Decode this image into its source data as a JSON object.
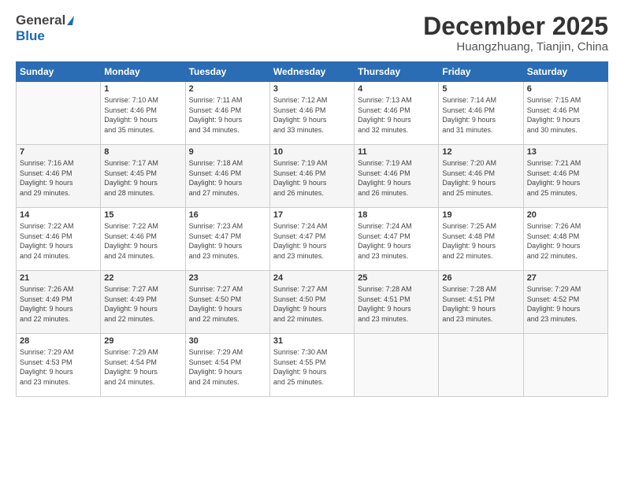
{
  "header": {
    "logo_general": "General",
    "logo_blue": "Blue",
    "month_title": "December 2025",
    "location": "Huangzhuang, Tianjin, China"
  },
  "days_of_week": [
    "Sunday",
    "Monday",
    "Tuesday",
    "Wednesday",
    "Thursday",
    "Friday",
    "Saturday"
  ],
  "weeks": [
    [
      {
        "day": "",
        "info": ""
      },
      {
        "day": "1",
        "info": "Sunrise: 7:10 AM\nSunset: 4:46 PM\nDaylight: 9 hours\nand 35 minutes."
      },
      {
        "day": "2",
        "info": "Sunrise: 7:11 AM\nSunset: 4:46 PM\nDaylight: 9 hours\nand 34 minutes."
      },
      {
        "day": "3",
        "info": "Sunrise: 7:12 AM\nSunset: 4:46 PM\nDaylight: 9 hours\nand 33 minutes."
      },
      {
        "day": "4",
        "info": "Sunrise: 7:13 AM\nSunset: 4:46 PM\nDaylight: 9 hours\nand 32 minutes."
      },
      {
        "day": "5",
        "info": "Sunrise: 7:14 AM\nSunset: 4:46 PM\nDaylight: 9 hours\nand 31 minutes."
      },
      {
        "day": "6",
        "info": "Sunrise: 7:15 AM\nSunset: 4:46 PM\nDaylight: 9 hours\nand 30 minutes."
      }
    ],
    [
      {
        "day": "7",
        "info": "Sunrise: 7:16 AM\nSunset: 4:46 PM\nDaylight: 9 hours\nand 29 minutes."
      },
      {
        "day": "8",
        "info": "Sunrise: 7:17 AM\nSunset: 4:45 PM\nDaylight: 9 hours\nand 28 minutes."
      },
      {
        "day": "9",
        "info": "Sunrise: 7:18 AM\nSunset: 4:46 PM\nDaylight: 9 hours\nand 27 minutes."
      },
      {
        "day": "10",
        "info": "Sunrise: 7:19 AM\nSunset: 4:46 PM\nDaylight: 9 hours\nand 26 minutes."
      },
      {
        "day": "11",
        "info": "Sunrise: 7:19 AM\nSunset: 4:46 PM\nDaylight: 9 hours\nand 26 minutes."
      },
      {
        "day": "12",
        "info": "Sunrise: 7:20 AM\nSunset: 4:46 PM\nDaylight: 9 hours\nand 25 minutes."
      },
      {
        "day": "13",
        "info": "Sunrise: 7:21 AM\nSunset: 4:46 PM\nDaylight: 9 hours\nand 25 minutes."
      }
    ],
    [
      {
        "day": "14",
        "info": "Sunrise: 7:22 AM\nSunset: 4:46 PM\nDaylight: 9 hours\nand 24 minutes."
      },
      {
        "day": "15",
        "info": "Sunrise: 7:22 AM\nSunset: 4:46 PM\nDaylight: 9 hours\nand 24 minutes."
      },
      {
        "day": "16",
        "info": "Sunrise: 7:23 AM\nSunset: 4:47 PM\nDaylight: 9 hours\nand 23 minutes."
      },
      {
        "day": "17",
        "info": "Sunrise: 7:24 AM\nSunset: 4:47 PM\nDaylight: 9 hours\nand 23 minutes."
      },
      {
        "day": "18",
        "info": "Sunrise: 7:24 AM\nSunset: 4:47 PM\nDaylight: 9 hours\nand 23 minutes."
      },
      {
        "day": "19",
        "info": "Sunrise: 7:25 AM\nSunset: 4:48 PM\nDaylight: 9 hours\nand 22 minutes."
      },
      {
        "day": "20",
        "info": "Sunrise: 7:26 AM\nSunset: 4:48 PM\nDaylight: 9 hours\nand 22 minutes."
      }
    ],
    [
      {
        "day": "21",
        "info": "Sunrise: 7:26 AM\nSunset: 4:49 PM\nDaylight: 9 hours\nand 22 minutes."
      },
      {
        "day": "22",
        "info": "Sunrise: 7:27 AM\nSunset: 4:49 PM\nDaylight: 9 hours\nand 22 minutes."
      },
      {
        "day": "23",
        "info": "Sunrise: 7:27 AM\nSunset: 4:50 PM\nDaylight: 9 hours\nand 22 minutes."
      },
      {
        "day": "24",
        "info": "Sunrise: 7:27 AM\nSunset: 4:50 PM\nDaylight: 9 hours\nand 22 minutes."
      },
      {
        "day": "25",
        "info": "Sunrise: 7:28 AM\nSunset: 4:51 PM\nDaylight: 9 hours\nand 23 minutes."
      },
      {
        "day": "26",
        "info": "Sunrise: 7:28 AM\nSunset: 4:51 PM\nDaylight: 9 hours\nand 23 minutes."
      },
      {
        "day": "27",
        "info": "Sunrise: 7:29 AM\nSunset: 4:52 PM\nDaylight: 9 hours\nand 23 minutes."
      }
    ],
    [
      {
        "day": "28",
        "info": "Sunrise: 7:29 AM\nSunset: 4:53 PM\nDaylight: 9 hours\nand 23 minutes."
      },
      {
        "day": "29",
        "info": "Sunrise: 7:29 AM\nSunset: 4:54 PM\nDaylight: 9 hours\nand 24 minutes."
      },
      {
        "day": "30",
        "info": "Sunrise: 7:29 AM\nSunset: 4:54 PM\nDaylight: 9 hours\nand 24 minutes."
      },
      {
        "day": "31",
        "info": "Sunrise: 7:30 AM\nSunset: 4:55 PM\nDaylight: 9 hours\nand 25 minutes."
      },
      {
        "day": "",
        "info": ""
      },
      {
        "day": "",
        "info": ""
      },
      {
        "day": "",
        "info": ""
      }
    ]
  ]
}
